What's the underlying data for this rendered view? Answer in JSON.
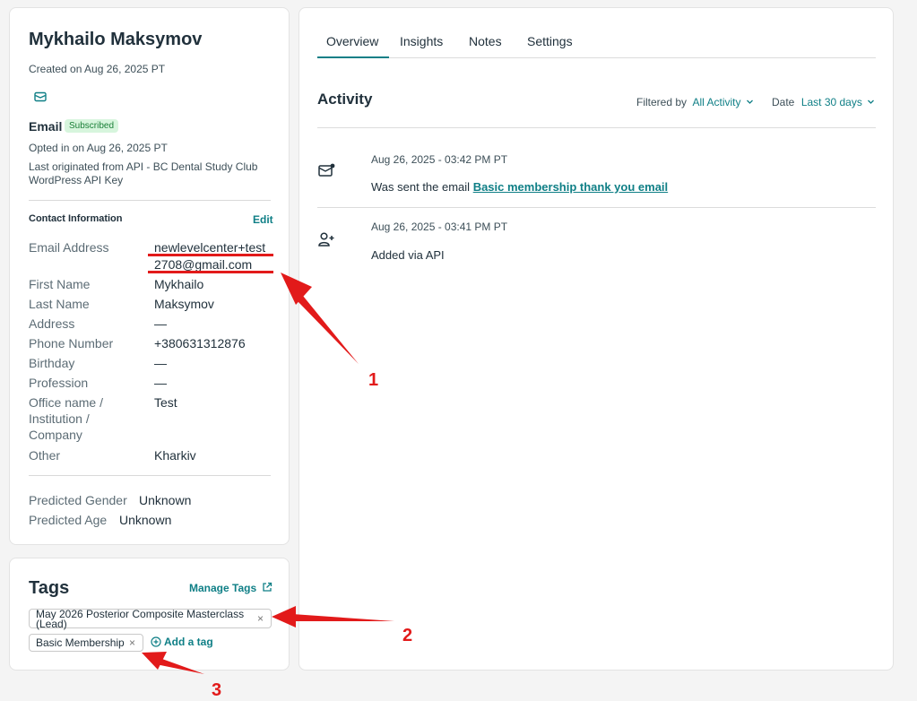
{
  "contact": {
    "name": "Mykhailo Maksymov",
    "created": "Created on Aug 26, 2025 PT",
    "email_section_title": "Email",
    "subscription_badge": "Subscribed",
    "opted_in": "Opted in on Aug 26, 2025 PT",
    "origin_line1": "Last originated from API - BC Dental Study Club",
    "origin_line2": "WordPress API Key",
    "contact_info_title": "Contact Information",
    "edit_label": "Edit",
    "fields": [
      {
        "label": "Email Address",
        "value_line1": "newlevelcenter+test",
        "value_line2": "2708@gmail.com"
      },
      {
        "label": "First Name",
        "value": "Mykhailo"
      },
      {
        "label": "Last Name",
        "value": "Maksymov"
      },
      {
        "label": "Address",
        "value": "—"
      },
      {
        "label": "Phone Number",
        "value": "+380631312876"
      },
      {
        "label": "Birthday",
        "value": "—"
      },
      {
        "label": "Profession",
        "value": "—"
      },
      {
        "label": "Office name / Institution / Company",
        "value": "Test"
      },
      {
        "label": "Other",
        "value": "Kharkiv"
      }
    ],
    "predicted": [
      {
        "label": "Predicted Gender",
        "value": "Unknown"
      },
      {
        "label": "Predicted Age",
        "value": "Unknown"
      }
    ]
  },
  "tags": {
    "title": "Tags",
    "manage_label": "Manage Tags",
    "items": [
      {
        "label_line1": "May 2026 Posterior Composite Masterclass",
        "label_line2": "(Lead)"
      },
      {
        "label": "Basic Membership"
      }
    ],
    "remove_symbol": "×",
    "add_label": "Add a tag"
  },
  "tabs": [
    "Overview",
    "Insights",
    "Notes",
    "Settings"
  ],
  "activity": {
    "title": "Activity",
    "filter_label": "Filtered by",
    "filter_value": "All Activity",
    "date_label": "Date",
    "date_value": "Last 30 days",
    "items": [
      {
        "icon": "email-sent-icon",
        "time": "Aug 26, 2025 - 03:42 PM PT",
        "text": "Was sent the email",
        "link": "Basic membership thank you email"
      },
      {
        "icon": "user-added-icon",
        "time": "Aug 26, 2025 - 03:41 PM PT",
        "text": "Added via API"
      }
    ]
  },
  "annotations": [
    "1",
    "2",
    "3"
  ],
  "colors": {
    "accent": "#0f7f86",
    "annotation": "#e21a1a",
    "badge_bg": "#d7f5dd"
  }
}
